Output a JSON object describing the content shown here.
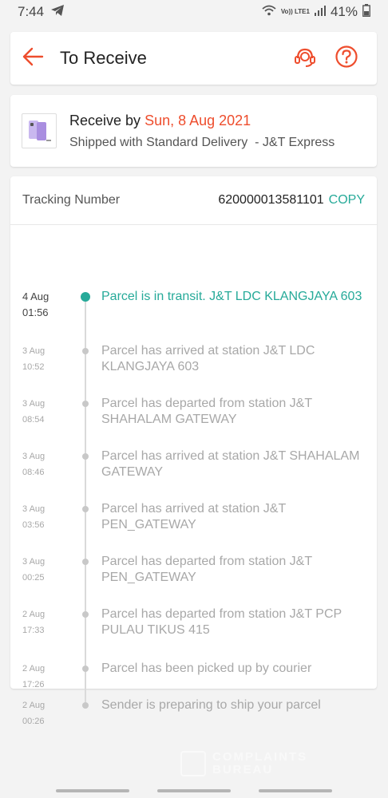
{
  "status_bar": {
    "time": "7:44",
    "volte": "Vo)) LTE1",
    "battery": "41%"
  },
  "header": {
    "title": "To Receive",
    "back_icon": "arrow-left-icon",
    "support_icon": "headset-icon",
    "help_icon": "question-circle-icon",
    "accent_color": "#ee4d2d"
  },
  "delivery": {
    "receive_label": "Receive by",
    "receive_date": "Sun, 8 Aug 2021",
    "shipping_line": "Shipped with Standard Delivery  - J&T Express"
  },
  "tracking": {
    "label": "Tracking Number",
    "number": "620000013581101",
    "copy_label": "COPY",
    "events": [
      {
        "date": "4 Aug",
        "time": "01:56",
        "text": "Parcel is in transit. J&T LDC KLANGJAYA 603",
        "active": true
      },
      {
        "date": "3 Aug",
        "time": "10:52",
        "text": "Parcel has arrived at station J&T LDC KLANGJAYA 603",
        "active": false
      },
      {
        "date": "3 Aug",
        "time": "08:54",
        "text": "Parcel has departed from station J&T SHAHALAM GATEWAY",
        "active": false
      },
      {
        "date": "3 Aug",
        "time": "08:46",
        "text": "Parcel has arrived at station J&T SHAHALAM GATEWAY",
        "active": false
      },
      {
        "date": "3 Aug",
        "time": "03:56",
        "text": "Parcel has arrived at station J&T PEN_GATEWAY",
        "active": false
      },
      {
        "date": "3 Aug",
        "time": "00:25",
        "text": "Parcel has departed from station J&T PEN_GATEWAY",
        "active": false
      },
      {
        "date": "2 Aug",
        "time": "17:33",
        "text": "Parcel has departed from station J&T PCP PULAU TIKUS 415",
        "active": false
      },
      {
        "date": "2 Aug",
        "time": "17:26",
        "text": "Parcel has been picked up by courier",
        "active": false
      },
      {
        "date": "2 Aug",
        "time": "00:26",
        "text": "Sender is preparing to ship your parcel",
        "active": false
      }
    ]
  },
  "colors": {
    "accent": "#ee4d2d",
    "teal": "#26aa99",
    "muted": "#a8a8a8"
  }
}
